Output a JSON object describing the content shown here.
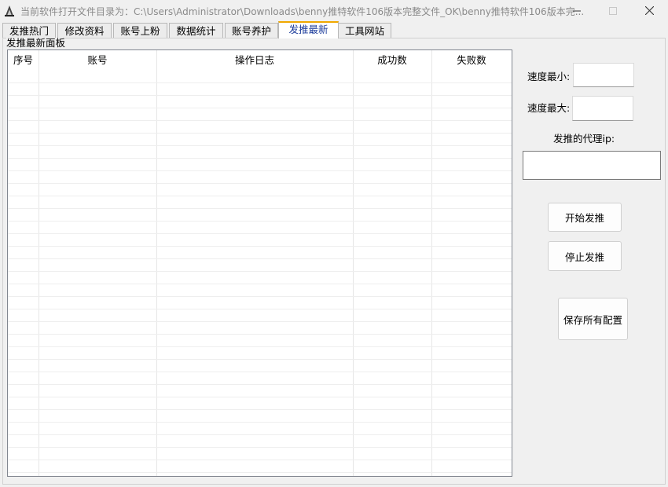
{
  "window": {
    "title": "当前软件打开文件目录为：C:\\Users\\Administrator\\Downloads\\benny推特软件106版本完整文件_OK\\benny推特软件106版本完..."
  },
  "tabs": [
    {
      "label": "发推热门"
    },
    {
      "label": "修改资料"
    },
    {
      "label": "账号上粉"
    },
    {
      "label": "数据统计"
    },
    {
      "label": "账号养护"
    },
    {
      "label": "发推最新",
      "active": true
    },
    {
      "label": "工具网站"
    }
  ],
  "panel": {
    "title": "发推最新面板",
    "columns": [
      "序号",
      "账号",
      "操作日志",
      "成功数",
      "失败数"
    ],
    "rows": []
  },
  "settings": {
    "speed_min_label": "速度最小:",
    "speed_min_value": "",
    "speed_max_label": "速度最大:",
    "speed_max_value": "",
    "proxy_label": "发推的代理ip:",
    "proxy_value": ""
  },
  "buttons": {
    "start": "开始发推",
    "stop": "停止发推",
    "save": "保存所有配置"
  },
  "icons": {
    "app": "app-logo-icon",
    "minimize": "minimize-icon",
    "maximize": "maximize-icon",
    "close": "close-icon"
  }
}
